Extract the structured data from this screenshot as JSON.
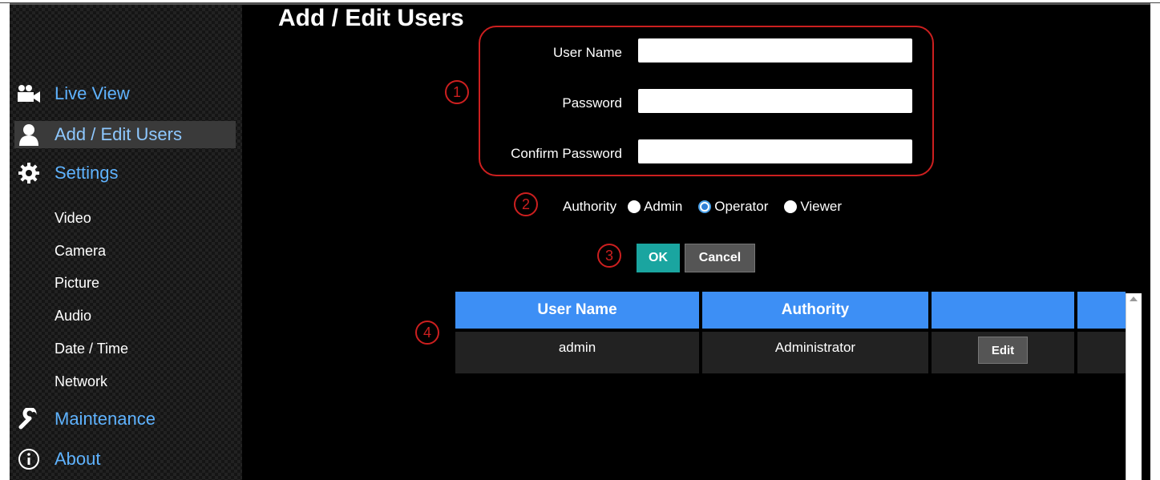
{
  "page": {
    "title": "Add / Edit Users"
  },
  "sidebar": {
    "items": [
      {
        "label": "Live View",
        "icon": "camera-people-icon",
        "active": false
      },
      {
        "label": "Add / Edit Users",
        "icon": "user-icon",
        "active": true
      },
      {
        "label": "Settings",
        "icon": "gear-icon",
        "active": false
      },
      {
        "label": "Maintenance",
        "icon": "wrench-icon",
        "active": false
      },
      {
        "label": "About",
        "icon": "info-icon",
        "active": false
      }
    ],
    "settings_subitems": [
      "Video",
      "Camera",
      "Picture",
      "Audio",
      "Date / Time",
      "Network"
    ]
  },
  "form": {
    "user_name_label": "User Name",
    "password_label": "Password",
    "confirm_password_label": "Confirm Password",
    "user_name_value": "",
    "password_value": "",
    "confirm_password_value": ""
  },
  "authority": {
    "label": "Authority",
    "options": [
      "Admin",
      "Operator",
      "Viewer"
    ],
    "selected": "Operator"
  },
  "buttons": {
    "ok": "OK",
    "cancel": "Cancel"
  },
  "annotations": [
    "1",
    "2",
    "3",
    "4"
  ],
  "table": {
    "headers": [
      "User Name",
      "Authority",
      "",
      ""
    ],
    "rows": [
      {
        "user_name": "admin",
        "authority": "Administrator",
        "action": "Edit"
      }
    ]
  },
  "colors": {
    "accent_blue": "#3d8ff5",
    "nav_link": "#5fb3ff",
    "ok_button": "#1aa5a0",
    "annotation_red": "#cc1f1f"
  }
}
